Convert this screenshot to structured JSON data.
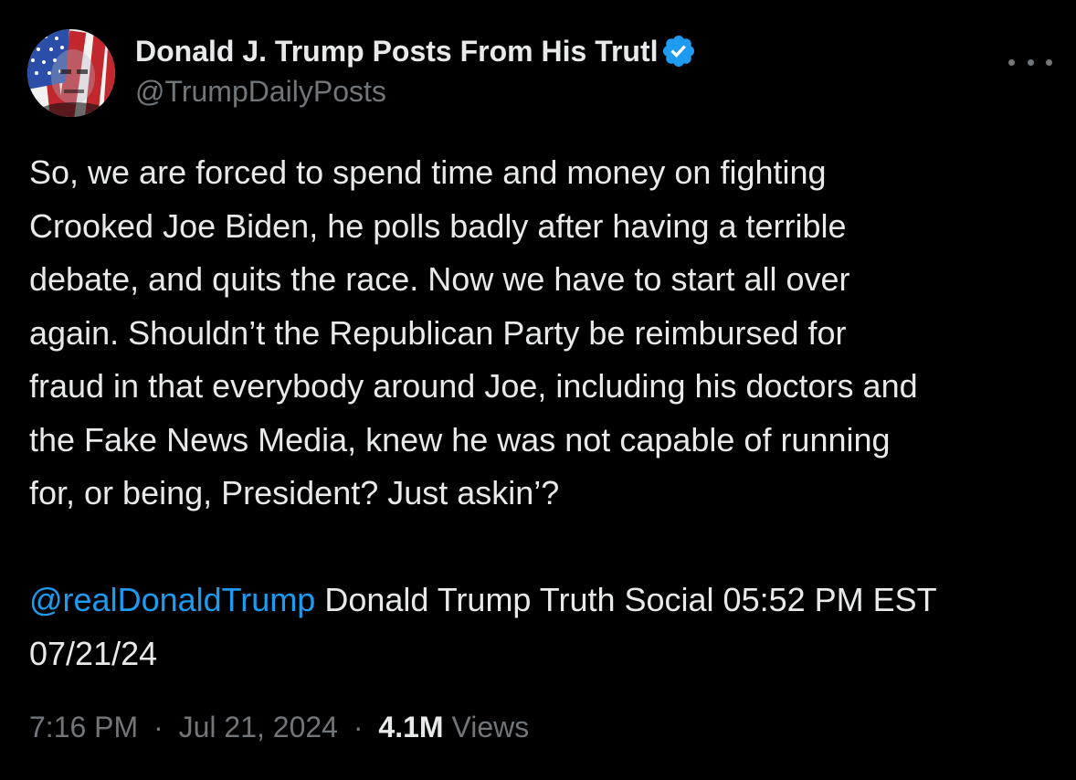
{
  "author": {
    "display_name": "Donald J. Trump Posts From His Trutl",
    "handle": "@TrumpDailyPosts",
    "verified_icon": "verified-badge-icon",
    "avatar_icon": "american-flag-portrait"
  },
  "more_icon": "more-options-icon",
  "post": {
    "lines": [
      "So, we are forced to spend time and money on fighting",
      "Crooked Joe Biden, he polls badly after having a terrible",
      "debate, and quits the race. Now we have to start all over",
      "again. Shouldn’t the Republican Party be reimbursed for",
      "fraud in that everybody around Joe, including his doctors and",
      "the Fake News Media, knew he was not capable of running",
      "for, or being, President? Just askin’?"
    ],
    "mention": "@realDonaldTrump",
    "source_line": " Donald Trump Truth Social 05:52 PM EST",
    "source_line_2": "07/21/24"
  },
  "meta": {
    "time": "7:16 PM",
    "separator": "·",
    "date": "Jul 21, 2024",
    "views_count": "4.1M",
    "views_label": " Views"
  },
  "colors": {
    "background": "#000000",
    "text": "#e7e9ea",
    "secondary": "#71767b",
    "link": "#1d9bf0"
  }
}
